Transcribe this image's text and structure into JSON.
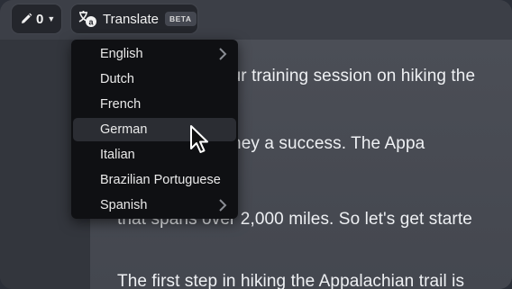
{
  "toolbar": {
    "edit_count": "0",
    "translate_label": "Translate",
    "beta_badge": "BETA"
  },
  "language_menu": {
    "items": [
      {
        "label": "English",
        "has_submenu": true
      },
      {
        "label": "Dutch",
        "has_submenu": false
      },
      {
        "label": "French",
        "has_submenu": false
      },
      {
        "label": "German",
        "has_submenu": false,
        "highlighted": true
      },
      {
        "label": "Italian",
        "has_submenu": false
      },
      {
        "label": "Brazilian Portuguese",
        "has_submenu": false
      },
      {
        "label": "Spanish",
        "has_submenu": true
      }
    ]
  },
  "document": {
    "lines": [
      "Welcome to your training session on hiking the",
      "make your journey a success. The Appa",
      "that spans over 2,000 miles. So let's get starte",
      "The first step in hiking the Appalachian trail is"
    ]
  },
  "colors": {
    "menu_bg": "#0f1013",
    "menu_highlight": "#2b2d33",
    "pill_bg": "#24262c"
  }
}
